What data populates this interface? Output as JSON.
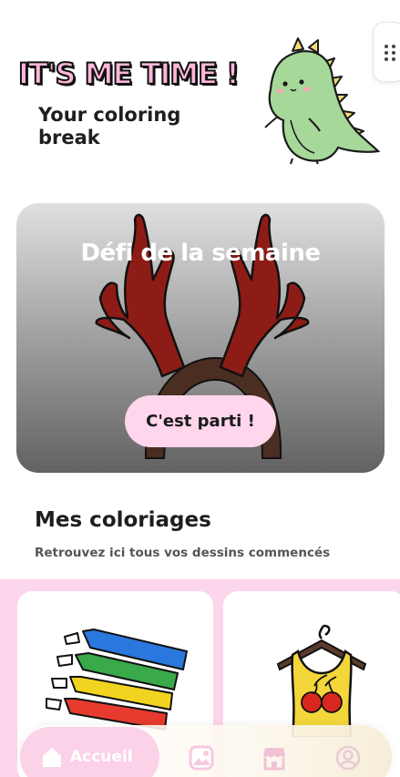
{
  "header": {
    "title": "IT'S ME TIME !",
    "subtitle": "Your coloring break",
    "mascot_icon": "green-dinosaur-icon"
  },
  "challenge": {
    "title": "Défi de la semaine",
    "button_label": "C'est parti !",
    "image": "reindeer-antlers-headband"
  },
  "my_colorings": {
    "title": "Mes coloriages",
    "subtitle": "Retrouvez ici tous vos dessins commencés",
    "cards": [
      {
        "image": "colored-markers"
      },
      {
        "image": "cherry-dress-on-hanger"
      }
    ]
  },
  "nav": {
    "home_label": "Accueil",
    "items": [
      "home-icon",
      "gallery-icon",
      "store-icon",
      "profile-icon"
    ]
  },
  "colors": {
    "pink": "#fcd6ea",
    "antler": "#8e1c16",
    "headband": "#4a2e22"
  }
}
